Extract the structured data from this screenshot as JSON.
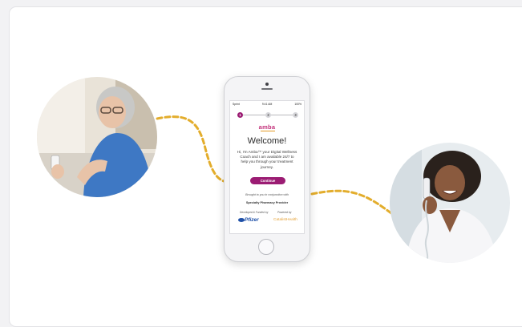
{
  "phone": {
    "status": {
      "carrier": "Sprint",
      "time": "9:41 AM",
      "battery": "100%"
    },
    "steps": [
      "1",
      "2",
      "3"
    ],
    "logo": "amba",
    "welcome": "Welcome!",
    "intro": "Hi, I'm Amba™ your Digital Wellness Coach and I am available 24/7 to help you through your treatment journey.",
    "continue_label": "Continue",
    "brought": "Brought to you in conjunction with",
    "provider": "Specialty Pharmacy Provider",
    "developed_label": "Developed & Funded by",
    "powered_label": "Powered by",
    "developer_logo": "Pfizer",
    "powered_logo": "CatalistHealth"
  },
  "colors": {
    "accent": "#9b1c73",
    "connector": "#e3ad2c",
    "logo": "#c2307a"
  }
}
